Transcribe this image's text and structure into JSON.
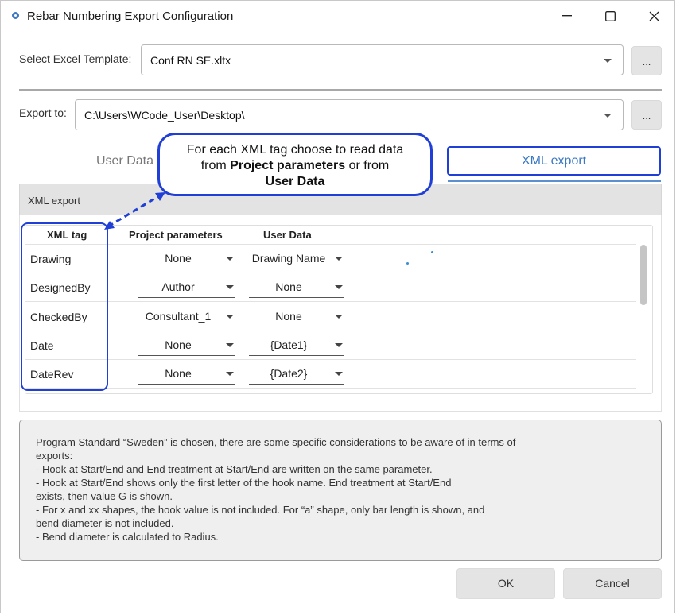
{
  "window": {
    "title": "Rebar Numbering Export Configuration"
  },
  "template": {
    "label": "Select Excel Template:",
    "value": "Conf RN SE.xltx",
    "browse_label": "..."
  },
  "export": {
    "label": "Export to:",
    "value": "C:\\Users\\WCode_User\\Desktop\\",
    "browse_label": "..."
  },
  "tabs": {
    "user_data": "User Data",
    "xml_export": "XML export"
  },
  "section": {
    "header": "XML export"
  },
  "table": {
    "headers": {
      "tag": "XML tag",
      "project": "Project parameters",
      "user": "User Data"
    },
    "rows": [
      {
        "tag": "Drawing",
        "project": "None",
        "user": "Drawing Name"
      },
      {
        "tag": "DesignedBy",
        "project": "Author",
        "user": "None"
      },
      {
        "tag": "CheckedBy",
        "project": "Consultant_1",
        "user": "None"
      },
      {
        "tag": "Date",
        "project": "None",
        "user": "{Date1}"
      },
      {
        "tag": "DateRev",
        "project": "None",
        "user": "{Date2}"
      }
    ]
  },
  "callout": {
    "line1": "For each XML tag choose to read data",
    "line2_pre": "from ",
    "line2_bold": "Project parameters",
    "line2_post": " or from",
    "line3_bold": "User Data"
  },
  "info": {
    "lines": [
      "Program Standard “Sweden” is chosen, there are some specific considerations to be aware of in terms of",
      "exports:",
      "- Hook at Start/End and End treatment at Start/End are written on the same parameter.",
      "- Hook at Start/End shows only the first letter of the hook name. End treatment at Start/End",
      "exists, then value G is shown.",
      "- For x and xx shapes, the hook value is not included. For “a” shape, only bar length is shown, and",
      "bend diameter is not included.",
      "- Bend diameter is calculated to Radius."
    ]
  },
  "buttons": {
    "ok": "OK",
    "cancel": "Cancel"
  },
  "colors": {
    "annotation_blue": "#1f3fd6",
    "tab_accent": "#3a78c2"
  }
}
